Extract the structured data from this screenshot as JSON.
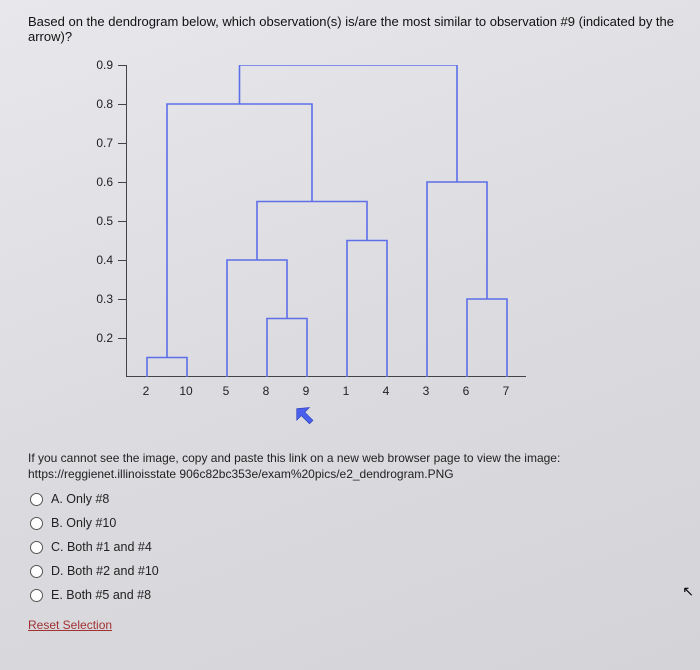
{
  "question": "Based on the dendrogram below, which observation(s) is/are the most similar to observation #9 (indicated by the arrow)?",
  "hint": "If you cannot see the image, copy and paste this link on a new web browser page to view the image: https://reggienet.illinoisstate  906c82bc353e/exam%20pics/e2_dendrogram.PNG",
  "options": {
    "a": "A. Only #8",
    "b": "B. Only #10",
    "c": "C. Both #1 and #4",
    "d": "D. Both #2 and #10",
    "e": "E. Both #5 and #8"
  },
  "reset": "Reset Selection",
  "chart_data": {
    "type": "dendrogram",
    "ylabel": "",
    "ylim": [
      0.1,
      0.9
    ],
    "y_ticks": [
      0.9,
      0.8,
      0.7,
      0.6,
      0.5,
      0.4,
      0.3,
      0.2
    ],
    "leaves": [
      "2",
      "10",
      "5",
      "8",
      "9",
      "1",
      "4",
      "3",
      "6",
      "7"
    ],
    "arrow_leaf": "9",
    "merges": [
      {
        "members": [
          "2",
          "10"
        ],
        "height": 0.15
      },
      {
        "members": [
          "8",
          "9"
        ],
        "height": 0.25
      },
      {
        "members": [
          "5",
          "8",
          "9"
        ],
        "height": 0.4
      },
      {
        "members": [
          "1",
          "4"
        ],
        "height": 0.45
      },
      {
        "members": [
          "5",
          "8",
          "9",
          "1",
          "4"
        ],
        "height": 0.55
      },
      {
        "members": [
          "2",
          "10",
          "5",
          "8",
          "9",
          "1",
          "4"
        ],
        "height": 0.8
      },
      {
        "members": [
          "6",
          "7"
        ],
        "height": 0.3
      },
      {
        "members": [
          "3",
          "6",
          "7"
        ],
        "height": 0.6
      },
      {
        "members": [
          "2",
          "10",
          "5",
          "8",
          "9",
          "1",
          "4",
          "3",
          "6",
          "7"
        ],
        "height": 0.9
      }
    ]
  }
}
